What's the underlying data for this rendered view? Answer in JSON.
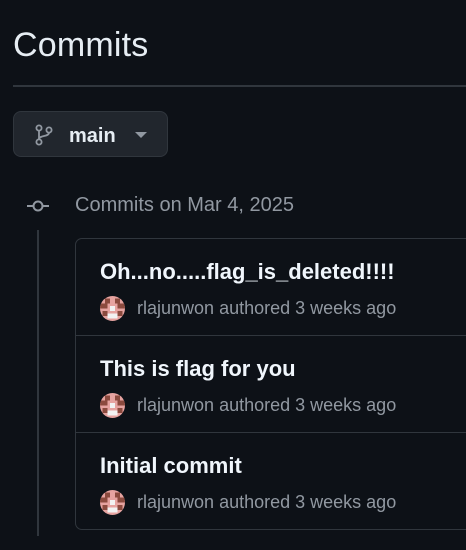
{
  "page": {
    "title": "Commits"
  },
  "branch": {
    "name": "main"
  },
  "commits": {
    "group_heading": "Commits on Mar 4, 2025",
    "items": [
      {
        "title": "Oh...no.....flag_is_deleted!!!!",
        "author": "rlajunwon",
        "action": "authored",
        "time": "3 weeks ago"
      },
      {
        "title": "This is flag for you",
        "author": "rlajunwon",
        "action": "authored",
        "time": "3 weeks ago"
      },
      {
        "title": "Initial commit",
        "author": "rlajunwon",
        "action": "authored",
        "time": "3 weeks ago"
      }
    ]
  },
  "colors": {
    "background": "#0d1117",
    "border": "#30363d",
    "muted_text": "#9198a1",
    "primary_text": "#f0f6fc",
    "avatar_pink": "#e6a3a0",
    "avatar_brown": "#8b4a3e"
  },
  "icons": {
    "branch": "git-branch-icon",
    "caret": "triangle-down-icon",
    "commit_node": "git-commit-icon",
    "avatar": "identicon"
  }
}
